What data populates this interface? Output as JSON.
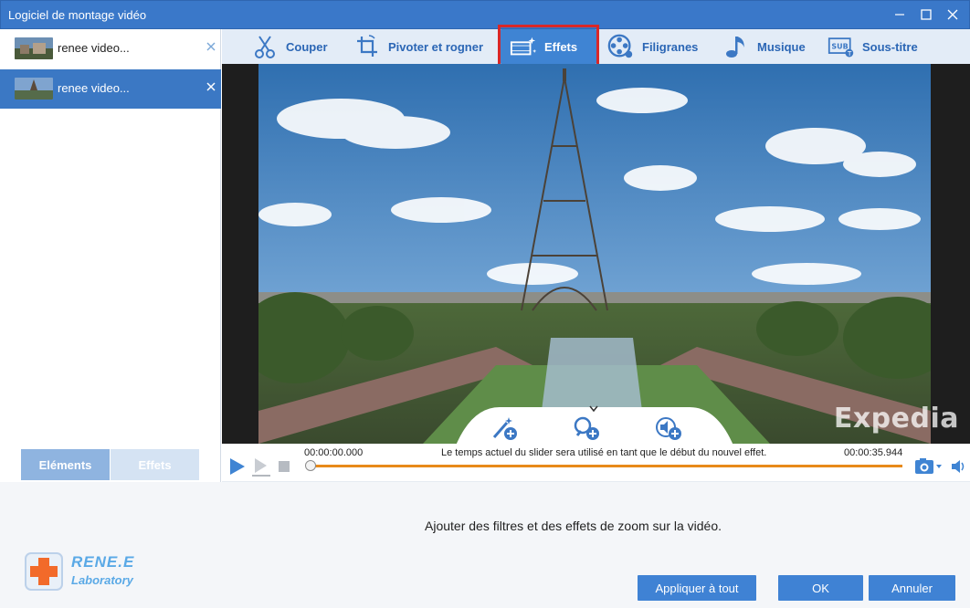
{
  "window": {
    "title": "Logiciel de montage vidéo"
  },
  "sidebar": {
    "items": [
      {
        "label": "renee video...",
        "selected": false
      },
      {
        "label": "renee video...",
        "selected": true
      }
    ],
    "tabs": [
      {
        "label": "Eléments",
        "active": true
      },
      {
        "label": "Effets",
        "active": false
      }
    ]
  },
  "toolbar": {
    "tools": [
      {
        "label": "Couper",
        "icon": "scissors-icon"
      },
      {
        "label": "Pivoter et rogner",
        "icon": "crop-rotate-icon"
      },
      {
        "label": "Effets",
        "icon": "film-sparkle-icon",
        "active": true
      },
      {
        "label": "Filigranes",
        "icon": "film-reel-icon"
      },
      {
        "label": "Musique",
        "icon": "music-note-icon"
      },
      {
        "label": "Sous-titre",
        "icon": "subtitle-icon"
      }
    ]
  },
  "preview": {
    "watermark": "Expedia",
    "overlay_buttons": [
      "add-filter-icon",
      "add-zoom-icon",
      "add-volume-icon"
    ]
  },
  "timeline": {
    "start_time": "00:00:00.000",
    "end_time": "00:00:35.944",
    "info": "Le temps actuel du slider sera utilisé en tant que le début du nouvel effet.",
    "position": 0
  },
  "bottom": {
    "description": "Ajouter des filtres et des effets de zoom sur la vidéo.",
    "apply_all": "Appliquer à tout",
    "ok": "OK",
    "cancel": "Annuler"
  },
  "logo": {
    "name": "RENE.E",
    "sub": "Laboratory"
  },
  "colors": {
    "accent": "#3f84d3",
    "titlebar": "#3a78c9",
    "highlight": "#d92727",
    "track": "#e88a1a"
  }
}
